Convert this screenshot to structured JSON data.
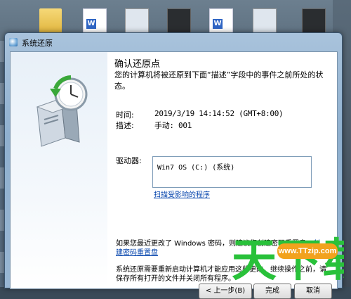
{
  "window": {
    "title": "系统还原",
    "heading": "确认还原点",
    "subheading": "您的计算机将被还原到下面“描述”字段中的事件之前所处的状态。",
    "time_label": "时间:",
    "time_value": "2019/3/19 14:14:52 (GMT+8:00)",
    "desc_label": "描述:",
    "desc_value": "手动: 001",
    "drive_label": "驱动器:",
    "drive_item": "Win7 OS (C:) (系统)",
    "scan_link": "扫描受影响的程序",
    "password_note_prefix": "如果您最近更改了 Windows 密码，则建议您创建密码重置盘。",
    "password_note_link": "创建密码重置盘",
    "restart_note": "系统还原需要重新启动计算机才能应用这些更改。继续操作之前，请保存所有打开的文件并关闭所有程序。",
    "back_button": "< 上一步(B)",
    "finish_button": "完成",
    "cancel_button": "取消"
  },
  "watermark": {
    "url": "www.TTzip.com",
    "text": "天下载"
  }
}
